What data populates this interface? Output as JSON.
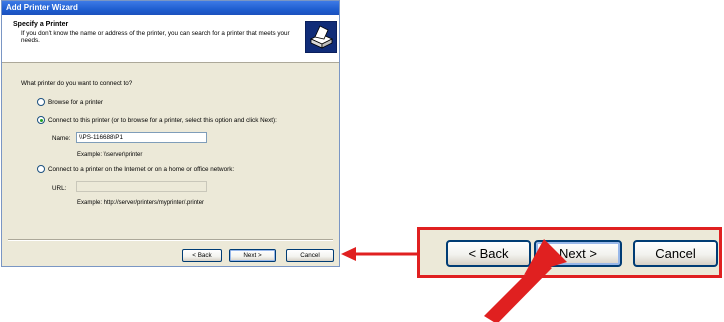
{
  "window": {
    "title": "Add Printer Wizard"
  },
  "header": {
    "title": "Specify a Printer",
    "subtitle": "If you don't know the name or address of the printer, you can search for a printer that meets your needs.",
    "icon": "printer-icon"
  },
  "question": "What printer do you want to connect to?",
  "options": {
    "browse": {
      "label": "Browse for a printer",
      "checked": false
    },
    "connect": {
      "label": "Connect to this printer (or to browse for a printer, select this option and click Next):",
      "checked": true
    },
    "internet": {
      "label": "Connect to a printer on the Internet or on a home or office network:",
      "checked": false
    }
  },
  "name_field": {
    "label": "Name:",
    "value": "\\\\PS-116688\\P1"
  },
  "name_example": "Example: \\\\server\\printer",
  "url_field": {
    "label": "URL:",
    "value": ""
  },
  "url_example": "Example: http://server/printers/myprinter/.printer",
  "buttons": {
    "back": "< Back",
    "next": "Next >",
    "cancel": "Cancel"
  },
  "colors": {
    "annotation": "#e02020",
    "titlebar": "#1f5ed0",
    "dialog_bg": "#ece9d8"
  }
}
